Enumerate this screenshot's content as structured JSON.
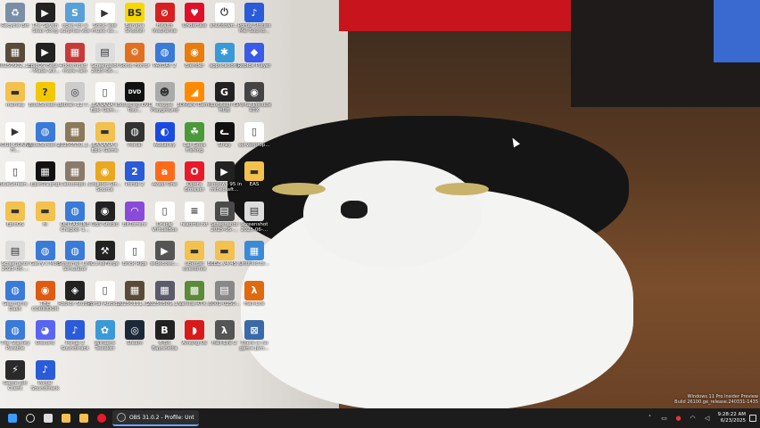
{
  "desktop_icons": [
    {
      "label": "Recycle Bin",
      "icon": "recycle-bin-icon",
      "color": "#7a8ea8",
      "glyph": "♻"
    },
    {
      "label": "The Seven Seas Song",
      "icon": "video-file-icon",
      "color": "#222222",
      "glyph": "▶"
    },
    {
      "label": "open for a surprise.vbs",
      "icon": "script-file-icon",
      "color": "#5aa0d8",
      "glyph": "S"
    },
    {
      "label": "Sonic exe music ex...",
      "icon": "media-file-icon",
      "color": "#ffffff",
      "glyph": "▶"
    },
    {
      "label": "Banana Shooter",
      "icon": "banana-shooter-icon",
      "color": "#f5d800",
      "glyph": "BS"
    },
    {
      "label": "Health Insurance",
      "icon": "no-sign-icon",
      "color": "#d82020",
      "glyph": "⊘"
    },
    {
      "label": "Undertale",
      "icon": "heart-icon",
      "color": "#e0102a",
      "glyph": "♥"
    },
    {
      "label": "shutdown...",
      "icon": "shutdown-file-icon",
      "color": "#ffffff",
      "glyph": "⏻"
    },
    {
      "label": "Portal Stories Mel Sound...",
      "icon": "music-note-icon",
      "color": "#2a5bd8",
      "glyph": "♪"
    },
    {
      "label": "20250902_1...",
      "icon": "photo-file-icon",
      "color": "#5a4a3a",
      "glyph": "▦"
    },
    {
      "label": "EpicOS Beta 4 - Made wit...",
      "icon": "video-file-icon",
      "color": "#222222",
      "glyph": "▶"
    },
    {
      "label": "download more ram",
      "icon": "photo-file-icon",
      "color": "#c83a3a",
      "glyph": "▦"
    },
    {
      "label": "Screenshot 2025-06-...",
      "icon": "screenshot-file-icon",
      "color": "#dddddd",
      "glyph": "▤"
    },
    {
      "label": "Sonic Horror",
      "icon": "sonic-horror-icon",
      "color": "#e07020",
      "glyph": "⚙"
    },
    {
      "label": "PAYDAY 2",
      "icon": "web-globe-icon",
      "color": "#3a7ad8",
      "glyph": "◍"
    },
    {
      "label": "Blender",
      "icon": "blender-icon",
      "color": "#e87d0d",
      "glyph": "◉"
    },
    {
      "label": "applications",
      "icon": "applications-icon",
      "color": "#3a9ad8",
      "glyph": "✱"
    },
    {
      "label": "Roblox Player",
      "icon": "roblox-icon",
      "color": "#3a5ae8",
      "glyph": "◆"
    },
    {
      "label": "memes",
      "icon": "folder-icon",
      "color": "#f2c14e",
      "glyph": "▬"
    },
    {
      "label": "BlueScreen...",
      "icon": "question-icon",
      "color": "#f2c800",
      "glyph": "?"
    },
    {
      "label": "debian-12.7...",
      "icon": "disc-image-icon",
      "color": "#cccccc",
      "glyph": "◎"
    },
    {
      "label": "BANANA's Epic Gam...",
      "icon": "document-icon",
      "color": "#ffffff",
      "glyph": "▯"
    },
    {
      "label": "Bouncing DVD Tool...",
      "icon": "dvd-icon",
      "color": "#111111",
      "glyph": "DVD"
    },
    {
      "label": "People Playground",
      "icon": "people-playground-icon",
      "color": "#aaaaaa",
      "glyph": "☻"
    },
    {
      "label": "3DMark Demo",
      "icon": "3dmark-icon",
      "color": "#ff8a00",
      "glyph": "◢"
    },
    {
      "label": "Logitech G HUB",
      "icon": "logitech-icon",
      "color": "#222222",
      "glyph": "G"
    },
    {
      "label": "Portal Prelude RTX",
      "icon": "portal-rtx-icon",
      "color": "#444444",
      "glyph": "◉"
    },
    {
      "label": "YOUR GONNA FI...",
      "icon": "media-file-icon",
      "color": "#ffffff",
      "glyph": "▶"
    },
    {
      "label": "BlueScreen...",
      "icon": "web-globe-icon",
      "color": "#3a7ad8",
      "glyph": "◍"
    },
    {
      "label": "20250530_1...",
      "icon": "photo-file-icon",
      "color": "#8a7a5a",
      "glyph": "▦"
    },
    {
      "label": "BANANA's Epic Game",
      "icon": "folder-icon",
      "color": "#f2c14e",
      "glyph": "▬"
    },
    {
      "label": "Portal",
      "icon": "portal-icon",
      "color": "#333333",
      "glyph": "◍"
    },
    {
      "label": "Audacity",
      "icon": "audacity-icon",
      "color": "#1a4ae0",
      "glyph": "◐"
    },
    {
      "label": "Cat Goes Fishing",
      "icon": "cat-goes-fishing-icon",
      "color": "#4a9a3a",
      "glyph": "☘"
    },
    {
      "label": "Stray",
      "icon": "cat-icon",
      "color": "#111111",
      "glyph": "ᓚ"
    },
    {
      "label": "serverprop...",
      "icon": "document-icon",
      "color": "#ffffff",
      "glyph": "▯"
    },
    {
      "label": "BlueScreen...",
      "icon": "document-icon",
      "color": "#ffffff",
      "glyph": "▯"
    },
    {
      "label": "EpicOS.png",
      "icon": "photo-file-icon",
      "color": "#111111",
      "glyph": "▦"
    },
    {
      "label": "Catcompil...",
      "icon": "photo-file-icon",
      "color": "#8a7a6a",
      "glyph": "▦"
    },
    {
      "label": "Counter-Str... Source",
      "icon": "counter-strike-icon",
      "color": "#e8a820",
      "glyph": "◉"
    },
    {
      "label": "Portal 2",
      "icon": "portal-2-icon",
      "color": "#2a5bd8",
      "glyph": "2"
    },
    {
      "label": "Avast One",
      "icon": "avast-icon",
      "color": "#ff6a1a",
      "glyph": "a"
    },
    {
      "label": "Opera Browser",
      "icon": "opera-icon",
      "color": "#e81a2a",
      "glyph": "O"
    },
    {
      "label": "windows 95 in minecraft...",
      "icon": "video-file-icon",
      "color": "#222222",
      "glyph": "▶"
    },
    {
      "label": "EAS",
      "icon": "folder-icon",
      "color": "#f2c14e",
      "glyph": "▬"
    },
    {
      "label": "EpicOS",
      "icon": "folder-icon",
      "color": "#f2c14e",
      "glyph": "▬"
    },
    {
      "label": "hi",
      "icon": "folder-icon",
      "color": "#f2c14e",
      "glyph": "▬"
    },
    {
      "label": "DELTARUNE Chapter 1...",
      "icon": "web-globe-icon",
      "color": "#3a7ad8",
      "glyph": "◍"
    },
    {
      "label": "OBS Studio",
      "icon": "obs-icon",
      "color": "#222222",
      "glyph": "◉"
    },
    {
      "label": "BitTorrent",
      "icon": "bittorrent-icon",
      "color": "#8a4ad8",
      "glyph": "◠"
    },
    {
      "label": "Oracle VirtualBox",
      "icon": "document-icon",
      "color": "#ffffff",
      "glyph": "▯"
    },
    {
      "label": "readme.txt",
      "icon": "text-file-icon",
      "color": "#ffffff",
      "glyph": "≡"
    },
    {
      "label": "Screenshot 2025-05-...",
      "icon": "screenshot-file-icon",
      "color": "#4a4a4a",
      "glyph": "▤"
    },
    {
      "label": "Screenshot 2025-06-...",
      "icon": "screenshot-file-icon",
      "color": "#dddddd",
      "glyph": "▤"
    },
    {
      "label": "Screenshot 2025-06-...",
      "icon": "screenshot-file-icon",
      "color": "#dddddd",
      "glyph": "▤"
    },
    {
      "label": "Garry's Mod",
      "icon": "web-globe-icon",
      "color": "#3a7ad8",
      "glyph": "◍"
    },
    {
      "label": "Streamer Life Simulator",
      "icon": "web-globe-icon",
      "color": "#3a7ad8",
      "glyph": "◍"
    },
    {
      "label": "CurseForge",
      "icon": "curseforge-icon",
      "color": "#222222",
      "glyph": "⚒"
    },
    {
      "label": "Brick Rigs",
      "icon": "document-icon",
      "color": "#ffffff",
      "glyph": "▯"
    },
    {
      "label": "widecowc...",
      "icon": "video-file-icon",
      "color": "#555555",
      "glyph": "▶"
    },
    {
      "label": "ubercat overdrive",
      "icon": "folder-icon",
      "color": "#f2c14e",
      "glyph": "▬"
    },
    {
      "label": "BEEZ_v4.45...",
      "icon": "folder-icon",
      "color": "#f2c14e",
      "glyph": "▬"
    },
    {
      "label": "Untitled.bl...",
      "icon": "blender-file-icon",
      "color": "#3a8ad8",
      "glyph": "▦"
    },
    {
      "label": "Geometry Dash",
      "icon": "web-globe-icon",
      "color": "#3a7ad8",
      "glyph": "◍"
    },
    {
      "label": "THE CORRIDOR",
      "icon": "the-corridor-icon",
      "color": "#e05a10",
      "glyph": "◉"
    },
    {
      "label": "Roblox Studio",
      "icon": "roblox-studio-icon",
      "color": "#222222",
      "glyph": "◈"
    },
    {
      "label": "Portal Audio...",
      "icon": "document-icon",
      "color": "#ffffff",
      "glyph": "▯"
    },
    {
      "label": "20250111_0...",
      "icon": "photo-file-icon",
      "color": "#5a4a3a",
      "glyph": "▦"
    },
    {
      "label": "20250509_1...",
      "icon": "photo-file-icon",
      "color": "#5a5a6a",
      "glyph": "▦"
    },
    {
      "label": "Vanilla-RTX...",
      "icon": "minecraft-icon",
      "color": "#5a8a3a",
      "glyph": "▩"
    },
    {
      "label": "0001-0250...",
      "icon": "screenshot-file-icon",
      "color": "#888888",
      "glyph": "▤"
    },
    {
      "label": "Half-Life",
      "icon": "half-life-icon",
      "color": "#e06a10",
      "glyph": "λ"
    },
    {
      "label": "The Stanley Parable",
      "icon": "web-globe-icon",
      "color": "#3a7ad8",
      "glyph": "◍"
    },
    {
      "label": "Discord",
      "icon": "discord-icon",
      "color": "#5865f2",
      "glyph": "◕"
    },
    {
      "label": "Portal 2 Soundtrack",
      "icon": "music-note-icon",
      "color": "#2a5bd8",
      "glyph": "♪"
    },
    {
      "label": "Winaero Tweaker",
      "icon": "winaero-icon",
      "color": "#3a9ad8",
      "glyph": "✿"
    },
    {
      "label": "Steam",
      "icon": "steam-icon",
      "color": "#1b2838",
      "glyph": "◎"
    },
    {
      "label": "8-Bit Bayonetta",
      "icon": "bayonetta-icon",
      "color": "#222222",
      "glyph": "B"
    },
    {
      "label": "Among Us",
      "icon": "among-us-icon",
      "color": "#d81a1a",
      "glyph": "◗"
    },
    {
      "label": "Half-Life 2",
      "icon": "half-life-2-icon",
      "color": "#555555",
      "glyph": "λ"
    },
    {
      "label": "There is no game Jam...",
      "icon": "there-is-no-game-icon",
      "color": "#3a6aa8",
      "glyph": "⊠"
    },
    {
      "label": "Game Jolt Client",
      "icon": "game-jolt-icon",
      "color": "#2a2a2a",
      "glyph": "⚡"
    },
    {
      "label": "Portal Soundtrack",
      "icon": "music-note-icon",
      "color": "#2a5bd8",
      "glyph": "♪"
    }
  ],
  "watermark": {
    "line1": "Windows 11 Pro Insider Preview",
    "line2": "Build 26100.ge_release.240331-1435"
  },
  "taskbar": {
    "pinned": [
      {
        "name": "start-button",
        "icon": "windows-logo-icon",
        "color": "#3a9cff"
      },
      {
        "name": "search-button",
        "icon": "search-icon",
        "color": "#dddddd"
      },
      {
        "name": "task-view-button",
        "icon": "task-view-icon",
        "color": "#dddddd"
      },
      {
        "name": "explorer-button",
        "icon": "file-explorer-icon",
        "color": "#f2c14e"
      },
      {
        "name": "store-button",
        "icon": "store-icon",
        "color": "#f2c14e"
      },
      {
        "name": "opera-taskbar-button",
        "icon": "opera-icon",
        "color": "#e81a2a"
      }
    ],
    "active_app": {
      "label": "OBS 31.0.2 - Profile: Unt",
      "icon": "obs-icon"
    },
    "clock": {
      "time": "9:28:22 AM",
      "date": "6/23/2025"
    }
  }
}
